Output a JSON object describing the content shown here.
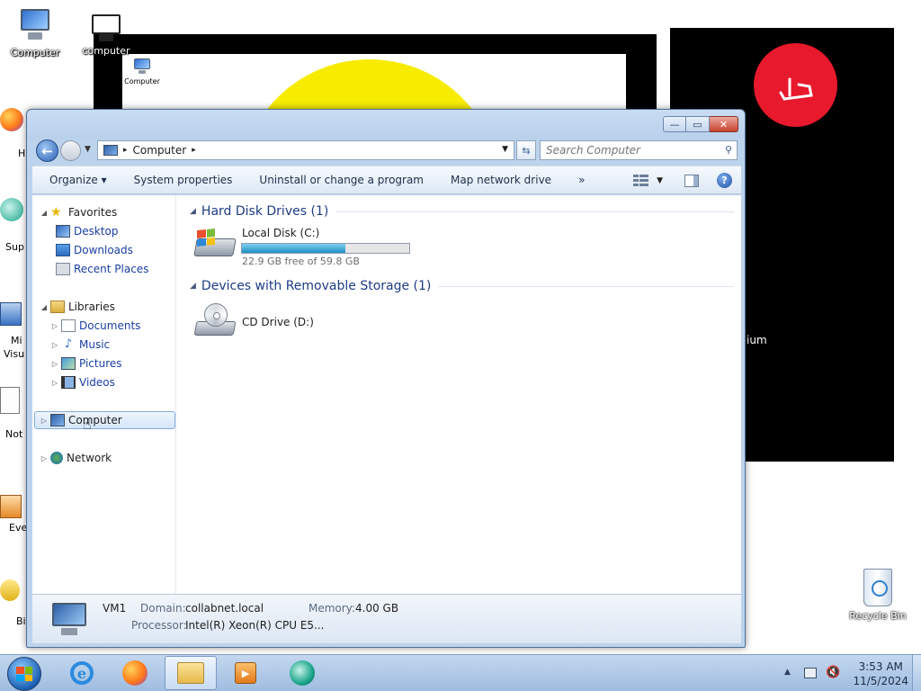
{
  "desktop": {
    "icons": [
      {
        "label": "Computer"
      },
      {
        "label": "computer"
      },
      {
        "label": "Computer"
      },
      {
        "label": "Recycle Bin"
      }
    ],
    "edge_labels": [
      "H",
      "Sup",
      "Mi",
      "Visu",
      "Not",
      "Eve",
      "Bi"
    ],
    "partial_label": "ium"
  },
  "window": {
    "caption": {
      "minimize": "—",
      "maximize": "▭",
      "close": "✕"
    },
    "address": {
      "crumb": "Computer",
      "arrow": "▸"
    },
    "search": {
      "placeholder": "Search Computer"
    },
    "toolbar": {
      "organize": "Organize ▾",
      "system_properties": "System properties",
      "uninstall": "Uninstall or change a program",
      "map_drive": "Map network drive",
      "more": "»"
    },
    "navpane": {
      "favorites": "Favorites",
      "desktop": "Desktop",
      "downloads": "Downloads",
      "recent_places": "Recent Places",
      "libraries": "Libraries",
      "documents": "Documents",
      "music": "Music",
      "pictures": "Pictures",
      "videos": "Videos",
      "computer": "Computer",
      "network": "Network"
    },
    "groups": {
      "hard_disk": "Hard Disk Drives (1)",
      "removable": "Devices with Removable Storage (1)"
    },
    "drives": {
      "c_name": "Local Disk (C:)",
      "c_free": "22.9 GB free of 59.8 GB",
      "c_used_fraction": 0.617,
      "d_name": "CD Drive (D:)"
    },
    "details": {
      "name": "VM1",
      "domain_label": "Domain:",
      "domain_value": "collabnet.local",
      "memory_label": "Memory:",
      "memory_value": "4.00 GB",
      "processor_label": "Processor:",
      "processor_value": "Intel(R) Xeon(R) CPU E5..."
    }
  },
  "taskbar": {
    "clock_time": "3:53 AM",
    "clock_date": "11/5/2024",
    "media_glyph": "▶"
  },
  "colors": {
    "accent_link": "#1a3fa3",
    "group_header": "#1e3b84",
    "red_button": "#e8192c",
    "sun_yellow": "#f7ec00"
  }
}
